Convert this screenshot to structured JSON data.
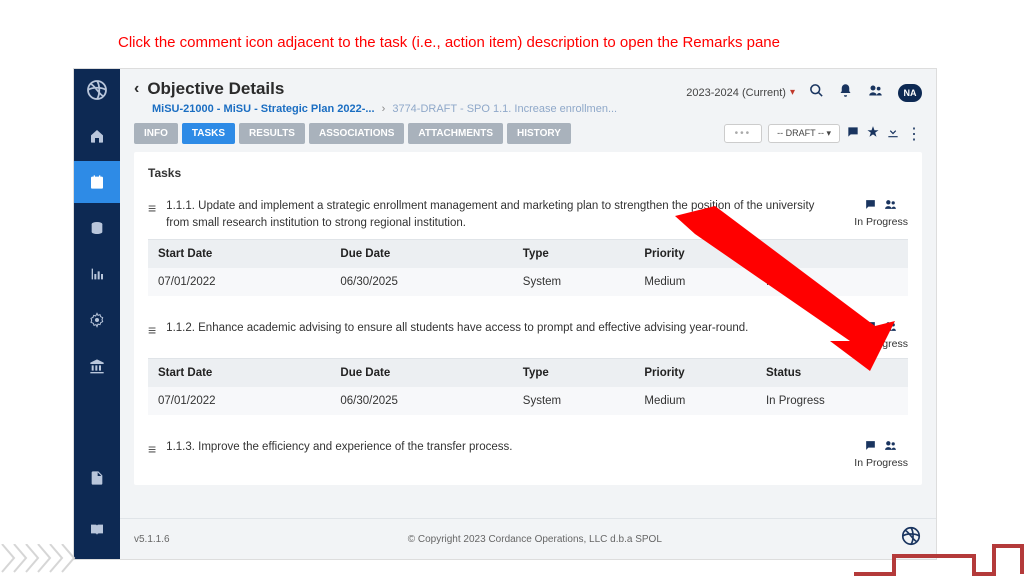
{
  "annotation": "Click the comment icon adjacent to the task (i.e., action item) description to open the Remarks pane",
  "header": {
    "page_title": "Objective Details",
    "breadcrumb_root": "MiSU-21000 - MiSU - Strategic Plan 2022-...",
    "breadcrumb_current": "3774-DRAFT - SPO 1.1. Increase enrollmen...",
    "period": "2023-2024 (Current)",
    "avatar": "NA"
  },
  "tabs": {
    "info": "INFO",
    "tasks": "TASKS",
    "results": "RESULTS",
    "assoc": "ASSOCIATIONS",
    "attach": "ATTACHMENTS",
    "history": "HISTORY",
    "draft": "-- DRAFT --"
  },
  "panel_title": "Tasks",
  "columns": {
    "start": "Start Date",
    "due": "Due Date",
    "type": "Type",
    "priority": "Priority",
    "status": "Status"
  },
  "tasks": [
    {
      "desc": "1.1.1. Update and implement a strategic enrollment management and marketing plan to strengthen the position of the university from small research institution to strong regional institution.",
      "status_badge": "In Progress",
      "start": "07/01/2022",
      "due": "06/30/2025",
      "type": "System",
      "priority": "Medium",
      "status": "In Progress",
      "status_partial": "In Pr"
    },
    {
      "desc": "1.1.2. Enhance academic advising to ensure all students have access to prompt and effective advising year-round.",
      "status_badge": "In Progress",
      "start": "07/01/2022",
      "due": "06/30/2025",
      "type": "System",
      "priority": "Medium",
      "status": "In Progress"
    },
    {
      "desc": "1.1.3. Improve the efficiency and experience of the transfer process.",
      "status_badge": "In Progress"
    }
  ],
  "footer": {
    "version": "v5.1.1.6",
    "copyright": "© Copyright 2023 Cordance Operations, LLC d.b.a SPOL"
  }
}
